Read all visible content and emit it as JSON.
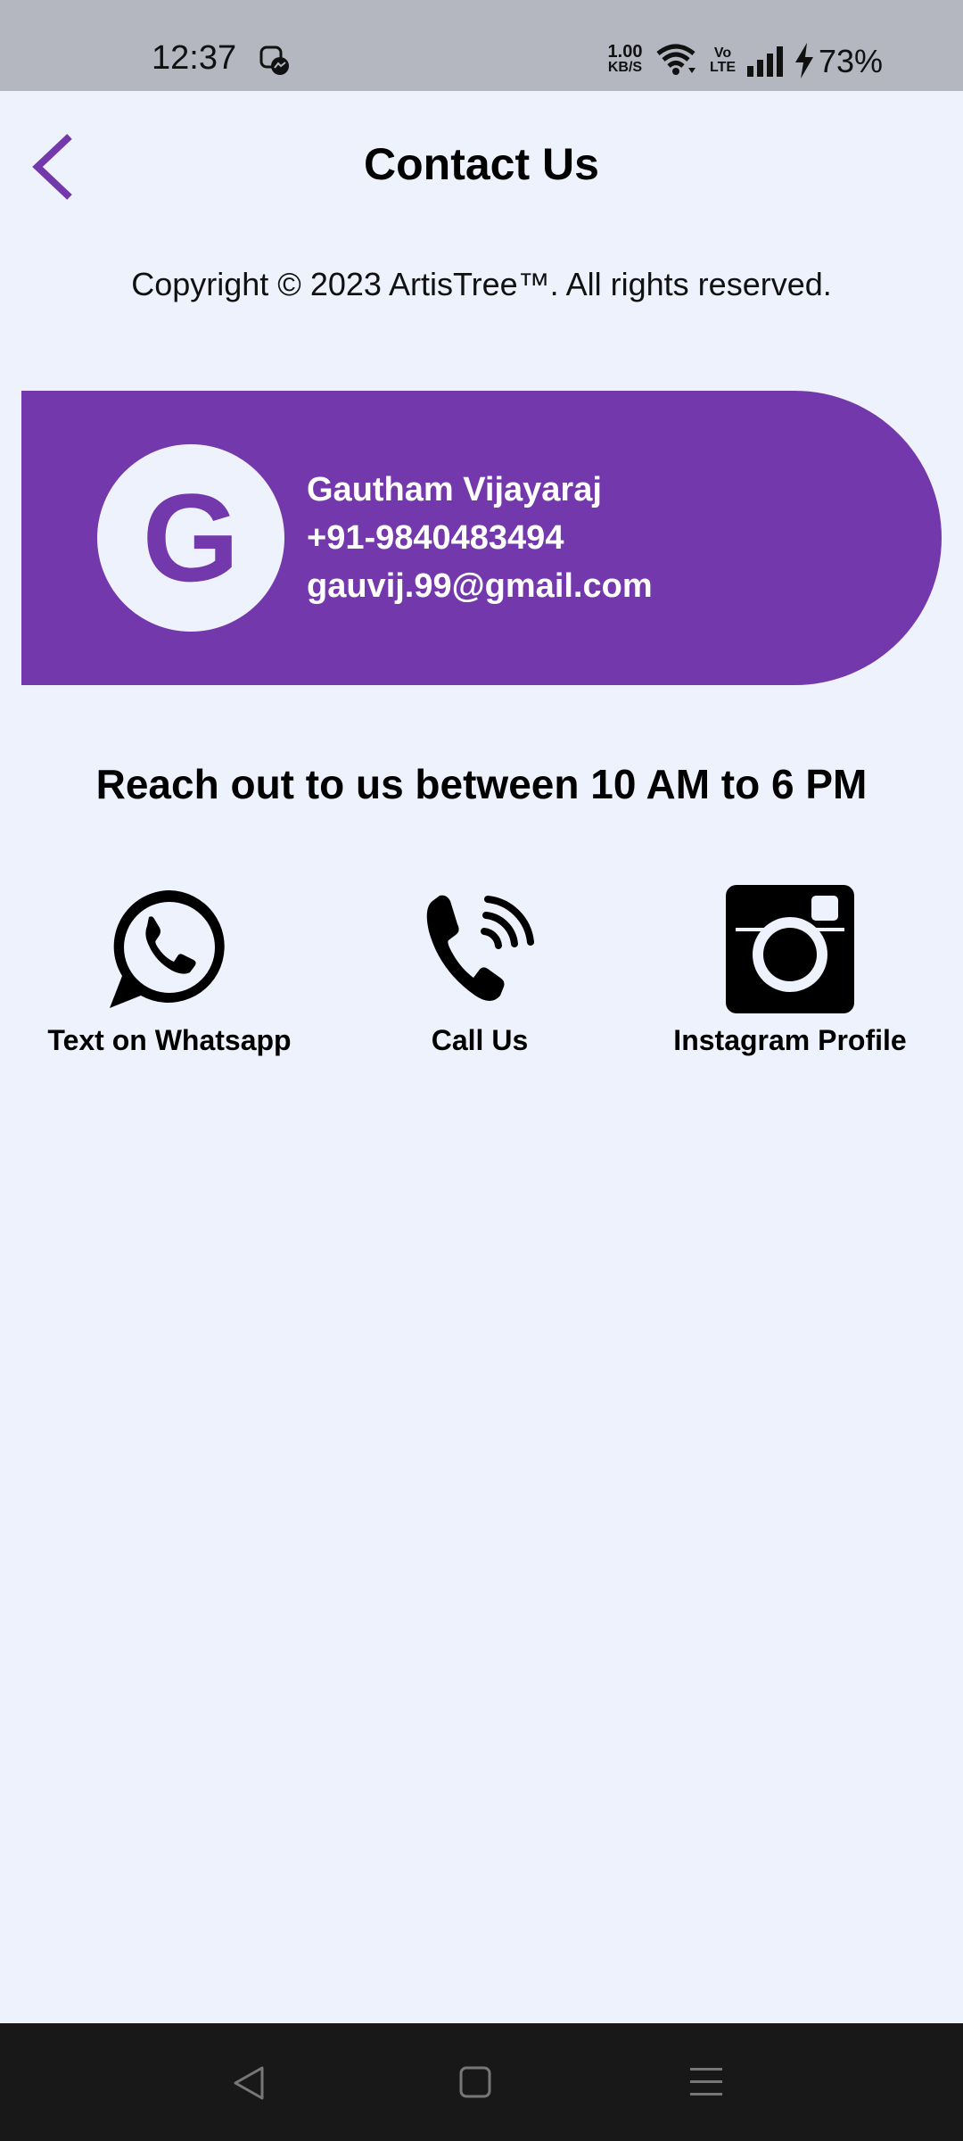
{
  "status_bar": {
    "time": "12:37",
    "net_speed_value": "1.00",
    "net_speed_unit": "KB/S",
    "volte_top": "Vo",
    "volte_bottom": "LTE",
    "battery": "73%",
    "icons": [
      "messenger-icon",
      "wifi-icon",
      "volte-icon",
      "signal-icon",
      "charging-icon"
    ]
  },
  "header": {
    "title": "Contact Us",
    "back_icon": "chevron-left-icon"
  },
  "copyright": "Copyright © 2023 ArtisTree™. All rights reserved.",
  "contact_card": {
    "avatar_letter": "G",
    "name": "Gautham Vijayaraj",
    "phone": "+91-9840483494",
    "email": "gauvij.99@gmail.com"
  },
  "hours_text": "Reach out to us between 10 AM to 6 PM",
  "actions": [
    {
      "icon": "whatsapp-icon",
      "label": "Text on Whatsapp"
    },
    {
      "icon": "phone-icon",
      "label": "Call Us"
    },
    {
      "icon": "instagram-icon",
      "label": "Instagram Profile"
    }
  ],
  "nav_bar": {
    "buttons": [
      "back-icon",
      "home-icon",
      "recents-icon"
    ]
  },
  "colors": {
    "accent": "#7338ab",
    "background": "#eef2fd",
    "status_bar": "#b4b7c0",
    "nav_bar": "#181818"
  }
}
